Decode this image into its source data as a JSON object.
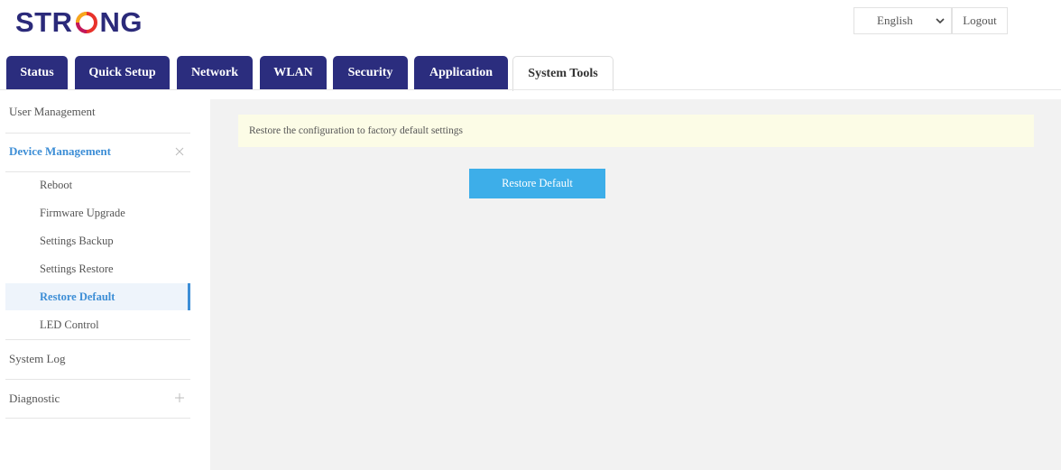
{
  "brand": {
    "logo_text_left": "STR",
    "logo_text_right": "NG"
  },
  "header": {
    "language": "English",
    "logout_label": "Logout"
  },
  "tabs": [
    {
      "label": "Status"
    },
    {
      "label": "Quick Setup"
    },
    {
      "label": "Network"
    },
    {
      "label": "WLAN"
    },
    {
      "label": "Security"
    },
    {
      "label": "Application"
    },
    {
      "label": "System Tools",
      "active": true
    }
  ],
  "sidebar": {
    "user_management": "User Management",
    "device_management": "Device Management",
    "device_sub": [
      {
        "label": "Reboot"
      },
      {
        "label": "Firmware Upgrade"
      },
      {
        "label": "Settings Backup"
      },
      {
        "label": "Settings Restore"
      },
      {
        "label": "Restore Default",
        "active": true
      },
      {
        "label": "LED Control"
      }
    ],
    "system_log": "System Log",
    "diagnostic": "Diagnostic"
  },
  "main": {
    "notice": "Restore the configuration to factory default settings",
    "restore_button": "Restore Default"
  },
  "colors": {
    "brand_navy": "#2b2d7e",
    "accent_blue": "#3d8ed6",
    "button_blue": "#3daee9",
    "notice_bg": "#fcfce6"
  }
}
